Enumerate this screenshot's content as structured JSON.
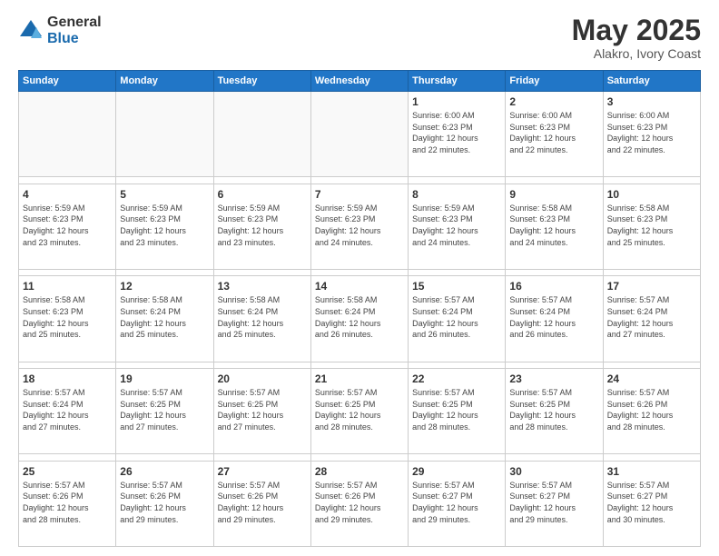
{
  "logo": {
    "general": "General",
    "blue": "Blue"
  },
  "header": {
    "title": "May 2025",
    "subtitle": "Alakro, Ivory Coast"
  },
  "weekdays": [
    "Sunday",
    "Monday",
    "Tuesday",
    "Wednesday",
    "Thursday",
    "Friday",
    "Saturday"
  ],
  "weeks": [
    [
      {
        "day": "",
        "info": ""
      },
      {
        "day": "",
        "info": ""
      },
      {
        "day": "",
        "info": ""
      },
      {
        "day": "",
        "info": ""
      },
      {
        "day": "1",
        "info": "Sunrise: 6:00 AM\nSunset: 6:23 PM\nDaylight: 12 hours\nand 22 minutes."
      },
      {
        "day": "2",
        "info": "Sunrise: 6:00 AM\nSunset: 6:23 PM\nDaylight: 12 hours\nand 22 minutes."
      },
      {
        "day": "3",
        "info": "Sunrise: 6:00 AM\nSunset: 6:23 PM\nDaylight: 12 hours\nand 22 minutes."
      }
    ],
    [
      {
        "day": "4",
        "info": "Sunrise: 5:59 AM\nSunset: 6:23 PM\nDaylight: 12 hours\nand 23 minutes."
      },
      {
        "day": "5",
        "info": "Sunrise: 5:59 AM\nSunset: 6:23 PM\nDaylight: 12 hours\nand 23 minutes."
      },
      {
        "day": "6",
        "info": "Sunrise: 5:59 AM\nSunset: 6:23 PM\nDaylight: 12 hours\nand 23 minutes."
      },
      {
        "day": "7",
        "info": "Sunrise: 5:59 AM\nSunset: 6:23 PM\nDaylight: 12 hours\nand 24 minutes."
      },
      {
        "day": "8",
        "info": "Sunrise: 5:59 AM\nSunset: 6:23 PM\nDaylight: 12 hours\nand 24 minutes."
      },
      {
        "day": "9",
        "info": "Sunrise: 5:58 AM\nSunset: 6:23 PM\nDaylight: 12 hours\nand 24 minutes."
      },
      {
        "day": "10",
        "info": "Sunrise: 5:58 AM\nSunset: 6:23 PM\nDaylight: 12 hours\nand 25 minutes."
      }
    ],
    [
      {
        "day": "11",
        "info": "Sunrise: 5:58 AM\nSunset: 6:23 PM\nDaylight: 12 hours\nand 25 minutes."
      },
      {
        "day": "12",
        "info": "Sunrise: 5:58 AM\nSunset: 6:24 PM\nDaylight: 12 hours\nand 25 minutes."
      },
      {
        "day": "13",
        "info": "Sunrise: 5:58 AM\nSunset: 6:24 PM\nDaylight: 12 hours\nand 25 minutes."
      },
      {
        "day": "14",
        "info": "Sunrise: 5:58 AM\nSunset: 6:24 PM\nDaylight: 12 hours\nand 26 minutes."
      },
      {
        "day": "15",
        "info": "Sunrise: 5:57 AM\nSunset: 6:24 PM\nDaylight: 12 hours\nand 26 minutes."
      },
      {
        "day": "16",
        "info": "Sunrise: 5:57 AM\nSunset: 6:24 PM\nDaylight: 12 hours\nand 26 minutes."
      },
      {
        "day": "17",
        "info": "Sunrise: 5:57 AM\nSunset: 6:24 PM\nDaylight: 12 hours\nand 27 minutes."
      }
    ],
    [
      {
        "day": "18",
        "info": "Sunrise: 5:57 AM\nSunset: 6:24 PM\nDaylight: 12 hours\nand 27 minutes."
      },
      {
        "day": "19",
        "info": "Sunrise: 5:57 AM\nSunset: 6:25 PM\nDaylight: 12 hours\nand 27 minutes."
      },
      {
        "day": "20",
        "info": "Sunrise: 5:57 AM\nSunset: 6:25 PM\nDaylight: 12 hours\nand 27 minutes."
      },
      {
        "day": "21",
        "info": "Sunrise: 5:57 AM\nSunset: 6:25 PM\nDaylight: 12 hours\nand 28 minutes."
      },
      {
        "day": "22",
        "info": "Sunrise: 5:57 AM\nSunset: 6:25 PM\nDaylight: 12 hours\nand 28 minutes."
      },
      {
        "day": "23",
        "info": "Sunrise: 5:57 AM\nSunset: 6:25 PM\nDaylight: 12 hours\nand 28 minutes."
      },
      {
        "day": "24",
        "info": "Sunrise: 5:57 AM\nSunset: 6:26 PM\nDaylight: 12 hours\nand 28 minutes."
      }
    ],
    [
      {
        "day": "25",
        "info": "Sunrise: 5:57 AM\nSunset: 6:26 PM\nDaylight: 12 hours\nand 28 minutes."
      },
      {
        "day": "26",
        "info": "Sunrise: 5:57 AM\nSunset: 6:26 PM\nDaylight: 12 hours\nand 29 minutes."
      },
      {
        "day": "27",
        "info": "Sunrise: 5:57 AM\nSunset: 6:26 PM\nDaylight: 12 hours\nand 29 minutes."
      },
      {
        "day": "28",
        "info": "Sunrise: 5:57 AM\nSunset: 6:26 PM\nDaylight: 12 hours\nand 29 minutes."
      },
      {
        "day": "29",
        "info": "Sunrise: 5:57 AM\nSunset: 6:27 PM\nDaylight: 12 hours\nand 29 minutes."
      },
      {
        "day": "30",
        "info": "Sunrise: 5:57 AM\nSunset: 6:27 PM\nDaylight: 12 hours\nand 29 minutes."
      },
      {
        "day": "31",
        "info": "Sunrise: 5:57 AM\nSunset: 6:27 PM\nDaylight: 12 hours\nand 30 minutes."
      }
    ]
  ]
}
